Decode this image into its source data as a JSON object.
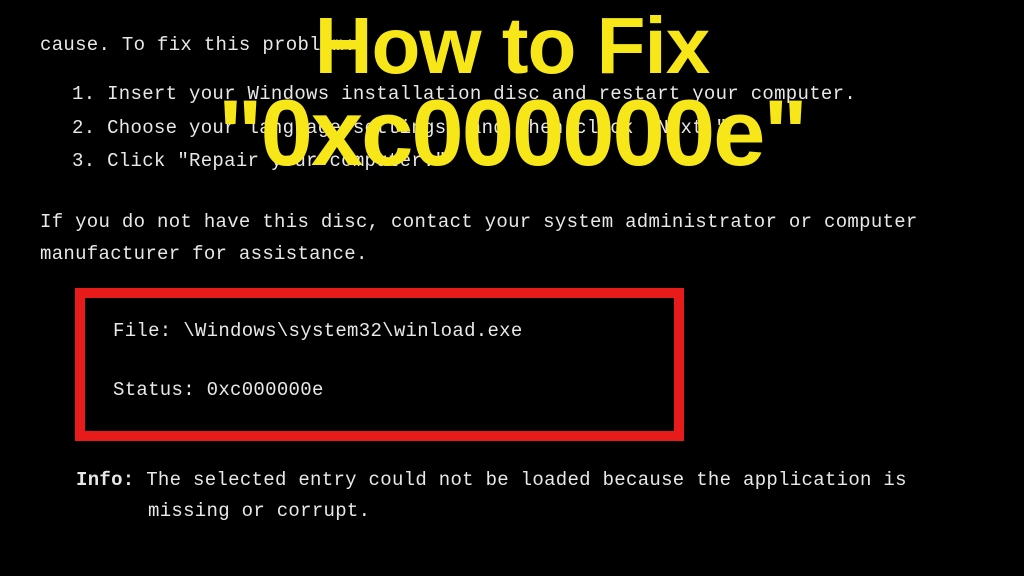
{
  "boot_error": {
    "intro_fragment": "cause. To fix this problem:",
    "steps": [
      "1. Insert your Windows installation disc and restart your computer.",
      "2. Choose your language settings, and then click \"Next.\"",
      "3. Click \"Repair your computer.\""
    ],
    "no_disk_line1": "If you do not have this disc, contact your system administrator or computer",
    "no_disk_line2": "manufacturer for assistance.",
    "file_label": "File:",
    "file_value": "\\Windows\\system32\\winload.exe",
    "status_label": "Status:",
    "status_value": "0xc000000e",
    "info_label": "Info:",
    "info_line1": "The selected entry could not be loaded because the application is",
    "info_line2": "missing or corrupt."
  },
  "overlay": {
    "title_line1": "How to Fix",
    "title_line2": "\"0xc000000e\""
  }
}
